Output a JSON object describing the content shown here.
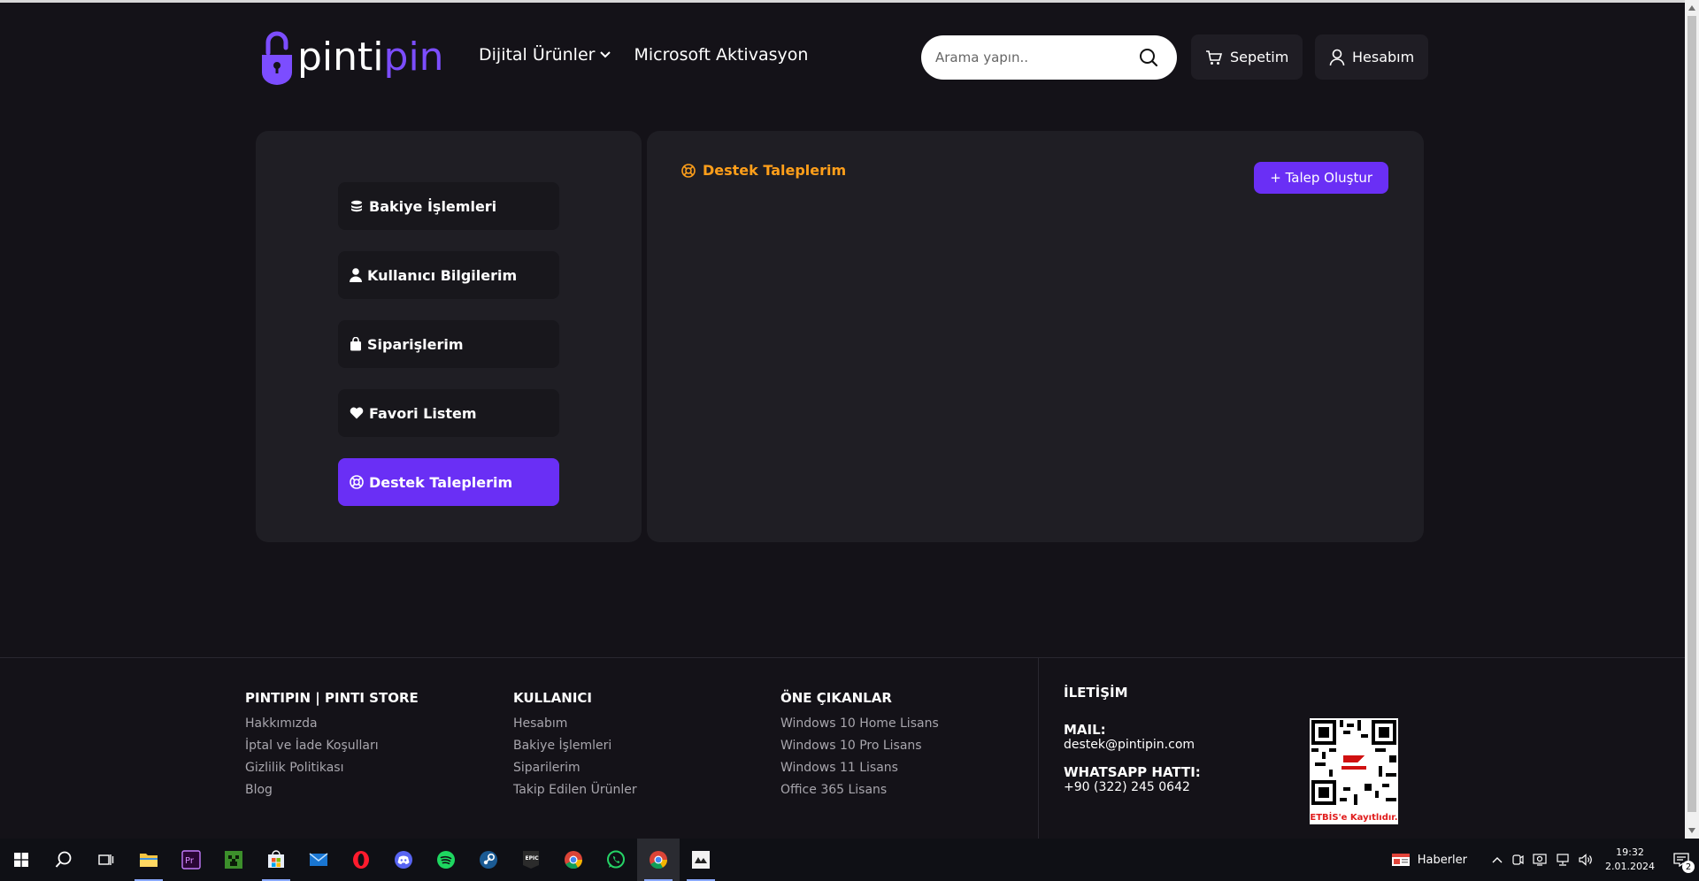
{
  "colors": {
    "accent": "#6a2ff5",
    "title_orange": "#ff9f1a",
    "background": "#141218",
    "panel": "#1f1e24"
  },
  "header": {
    "logo": {
      "part1": "pinti",
      "part2": "pin"
    },
    "nav": [
      {
        "label": "Dijital Ürünler",
        "icon": "chevron-down-icon"
      },
      {
        "label": "Microsoft Aktivasyon"
      }
    ],
    "search": {
      "placeholder": "Arama yapın.."
    },
    "cart_label": "Sepetim",
    "account_label": "Hesabım"
  },
  "sidebar": {
    "items": [
      {
        "label": "Bakiye İşlemleri",
        "icon": "coins-icon"
      },
      {
        "label": "Kullanıcı Bilgilerim",
        "icon": "user-icon"
      },
      {
        "label": "Siparişlerim",
        "icon": "shopping-bag-icon"
      },
      {
        "label": "Favori Listem",
        "icon": "heart-icon"
      },
      {
        "label": "Destek Taleplerim",
        "icon": "life-ring-icon",
        "active": true
      }
    ]
  },
  "main": {
    "title": "Destek Taleplerim",
    "new_ticket_label": "+ Talep Oluştur"
  },
  "footer": {
    "columns": [
      {
        "heading": "PINTIPIN | PINTI STORE",
        "links": [
          "Hakkımızda",
          "İptal ve İade Koşulları",
          "Gizlilik Politikası",
          "Blog"
        ]
      },
      {
        "heading": "KULLANICI",
        "links": [
          "Hesabım",
          "Bakiye İşlemleri",
          "Siparilerim",
          "Takip Edilen Ürünler"
        ]
      },
      {
        "heading": "ÖNE ÇIKANLAR",
        "links": [
          "Windows 10 Home Lisans",
          "Windows 10 Pro Lisans",
          "Windows 11 Lisans",
          "Office 365 Lisans"
        ]
      }
    ],
    "contact": {
      "heading": "İLETİŞİM",
      "mail_label": "MAIL:",
      "mail": "destek@pintipin.com",
      "whatsapp_label": "WHATSAPP HATTI:",
      "whatsapp": "+90 (322) 245 0642"
    },
    "etbis_caption": "ETBİS'e Kayıtlıdır."
  },
  "taskbar": {
    "apps": [
      "start-icon",
      "search-icon",
      "task-view-icon",
      "file-explorer-icon",
      "premiere-icon",
      "minecraft-icon",
      "store-icon",
      "mail-icon",
      "opera-icon",
      "discord-icon",
      "spotify-icon",
      "steam-icon",
      "epic-games-icon",
      "chrome-icon",
      "whatsapp-icon",
      "chrome-active-icon",
      "app-icon"
    ],
    "news_label": "Haberler",
    "time": "19:32",
    "date": "2.01.2024",
    "notification_count": "2"
  }
}
